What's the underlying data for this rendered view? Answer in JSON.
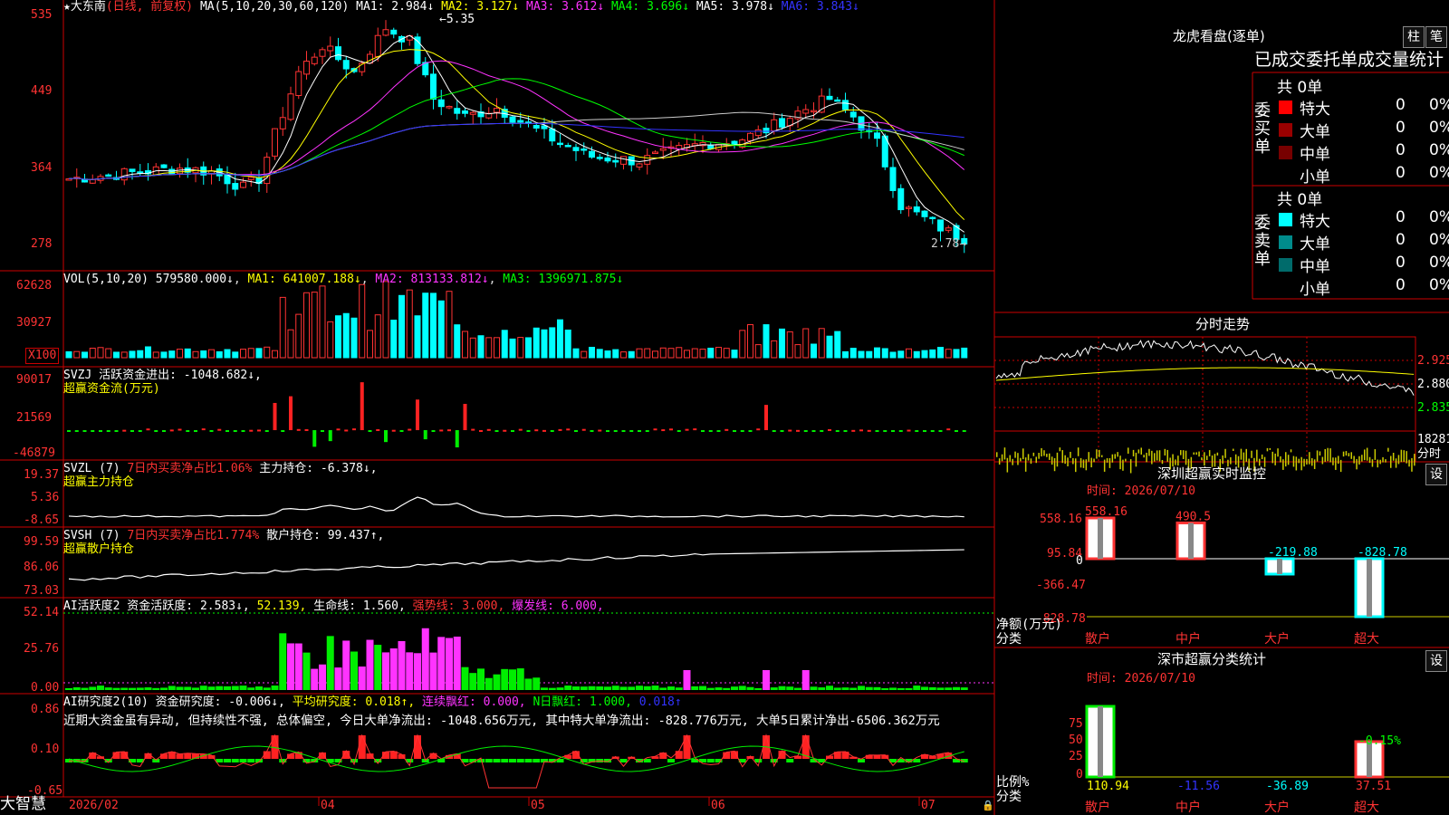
{
  "app": {
    "name": "大智慧"
  },
  "main_chart": {
    "stock": "★大东南",
    "period": "(日线, 前复权)",
    "ma_params": "MA(5,10,20,30,60,120)",
    "ma1": "MA1: 2.984↓",
    "ma2": "MA2: 3.127↓",
    "ma3": "MA3: 3.612↓",
    "ma4": "MA4: 3.696↓",
    "ma5": "MA5: 3.978↓",
    "ma6": "MA6: 3.843↓",
    "price_axis": [
      "535",
      "449",
      "364",
      "278"
    ],
    "high_mark": "5.35",
    "low_mark": "2.78"
  },
  "vol_panel": {
    "title": "VOL(5,10,20)",
    "value": "579580.000↓",
    "ma1": "MA1: 641007.188↓",
    "ma2": "MA2: 813133.812↓",
    "ma3": "MA3: 1396971.875↓",
    "axis": [
      "62628",
      "30927",
      "X100"
    ]
  },
  "svzj_panel": {
    "title": "SVZJ  活跃资金进出: -1048.682↓,",
    "subtitle": "超赢资金流(万元)",
    "axis": [
      "90017",
      "21569",
      "-46879"
    ]
  },
  "svzl_panel": {
    "title": "SVZL  (7)",
    "hint": "7日内买卖净占比1.06%",
    "value": "主力持仓: -6.378↓,",
    "subtitle": "超赢主力持仓",
    "axis": [
      "19.37",
      "5.36",
      "-8.65"
    ]
  },
  "svsh_panel": {
    "title": "SVSH  (7)",
    "hint": "7日内买卖净占比1.774%",
    "value": "散户持仓: 99.437↑,",
    "subtitle": "超赢散户持仓",
    "axis": [
      "99.59",
      "86.06",
      "73.03"
    ]
  },
  "ai_active_panel": {
    "title": "AI活跃度2 资金活跃度: 2.583↓,",
    "v2": "52.139,",
    "v3": "生命线: 1.560,",
    "v4": "强势线: 3.000,",
    "v5": "爆发线: 6.000,",
    "axis": [
      "52.14",
      "25.76",
      "0.00"
    ]
  },
  "ai_research_panel": {
    "title": "AI研究度2(10) 资金研究度: -0.006↓,",
    "v2": "平均研究度: 0.018↑,",
    "v3": "连续飘红: 0.000,",
    "v4": "N日飘红: 1.000,",
    "v5": "0.018↑",
    "comment": "近期大资金虽有异动, 但持续性不强, 总体偏空, 今日大单净流出: -1048.656万元, 其中特大单净流出: -828.776万元, 大单5日累计净出-6506.362万元",
    "axis": [
      "0.86",
      "0.10",
      "-0.65"
    ]
  },
  "date_axis": [
    "2026/02",
    "04",
    "05",
    "06",
    "07"
  ],
  "lhb": {
    "title": "龙虎看盘(逐单)",
    "btn1": "柱",
    "btn2": "笔",
    "tabs": "已成交委托单成交量统计",
    "buy_label": "委买单",
    "sell_label": "委卖单",
    "buy_total": "共 0单",
    "sell_total": "共 0单",
    "rows": [
      {
        "name": "特大",
        "count": "0",
        "pct": "0%"
      },
      {
        "name": "大单",
        "count": "0",
        "pct": "0%"
      },
      {
        "name": "中单",
        "count": "0",
        "pct": "0%"
      },
      {
        "name": "小单",
        "count": "0",
        "pct": "0%"
      }
    ],
    "colors": {
      "buy": [
        "#ff0000",
        "#990000",
        "#770000"
      ],
      "sell": [
        "#00ffff",
        "#008b8b",
        "#006b6b"
      ]
    }
  },
  "intraday": {
    "title": "分时走势",
    "axis": [
      "2.925",
      "2.880",
      "2.835",
      "18281",
      "分时"
    ]
  },
  "sz_monitor": {
    "title": "深圳超赢实时监控",
    "btn": "设",
    "time": "时间: 2026/07/10",
    "axis": [
      "558.16",
      "95.84",
      "0",
      "-366.47",
      "-828.78"
    ],
    "ylabel1": "净额(万元)",
    "ylabel2": "分类",
    "cats": [
      "散户",
      "中户",
      "大户",
      "超大"
    ],
    "labels": [
      "558.16",
      "490.5",
      "-219.88",
      "-828.78"
    ]
  },
  "sz_class": {
    "title": "深市超赢分类统计",
    "btn": "设",
    "time": "时间: 2026/07/10",
    "axis": [
      "75",
      "50",
      "25",
      "0"
    ],
    "ylabel1": "比例%",
    "ylabel2": "分类",
    "cats": [
      "散户",
      "中户",
      "大户",
      "超大"
    ],
    "values": [
      "110.94",
      "-11.56",
      "-36.89",
      "37.51"
    ],
    "top_label": "-0.15%"
  },
  "chart_data": [
    {
      "type": "bar",
      "title": "深圳超赢实时监控",
      "categories": [
        "散户",
        "中户",
        "大户",
        "超大"
      ],
      "values": [
        558.16,
        490.5,
        -219.88,
        -828.78
      ],
      "ylabel": "净额(万元)",
      "ylim": [
        -828.78,
        558.16
      ]
    },
    {
      "type": "bar",
      "title": "深市超赢分类统计",
      "categories": [
        "散户",
        "中户",
        "大户",
        "超大"
      ],
      "values": [
        110.94,
        -11.56,
        -36.89,
        37.51
      ],
      "ylabel": "比例%",
      "ylim": [
        0,
        75
      ]
    }
  ]
}
